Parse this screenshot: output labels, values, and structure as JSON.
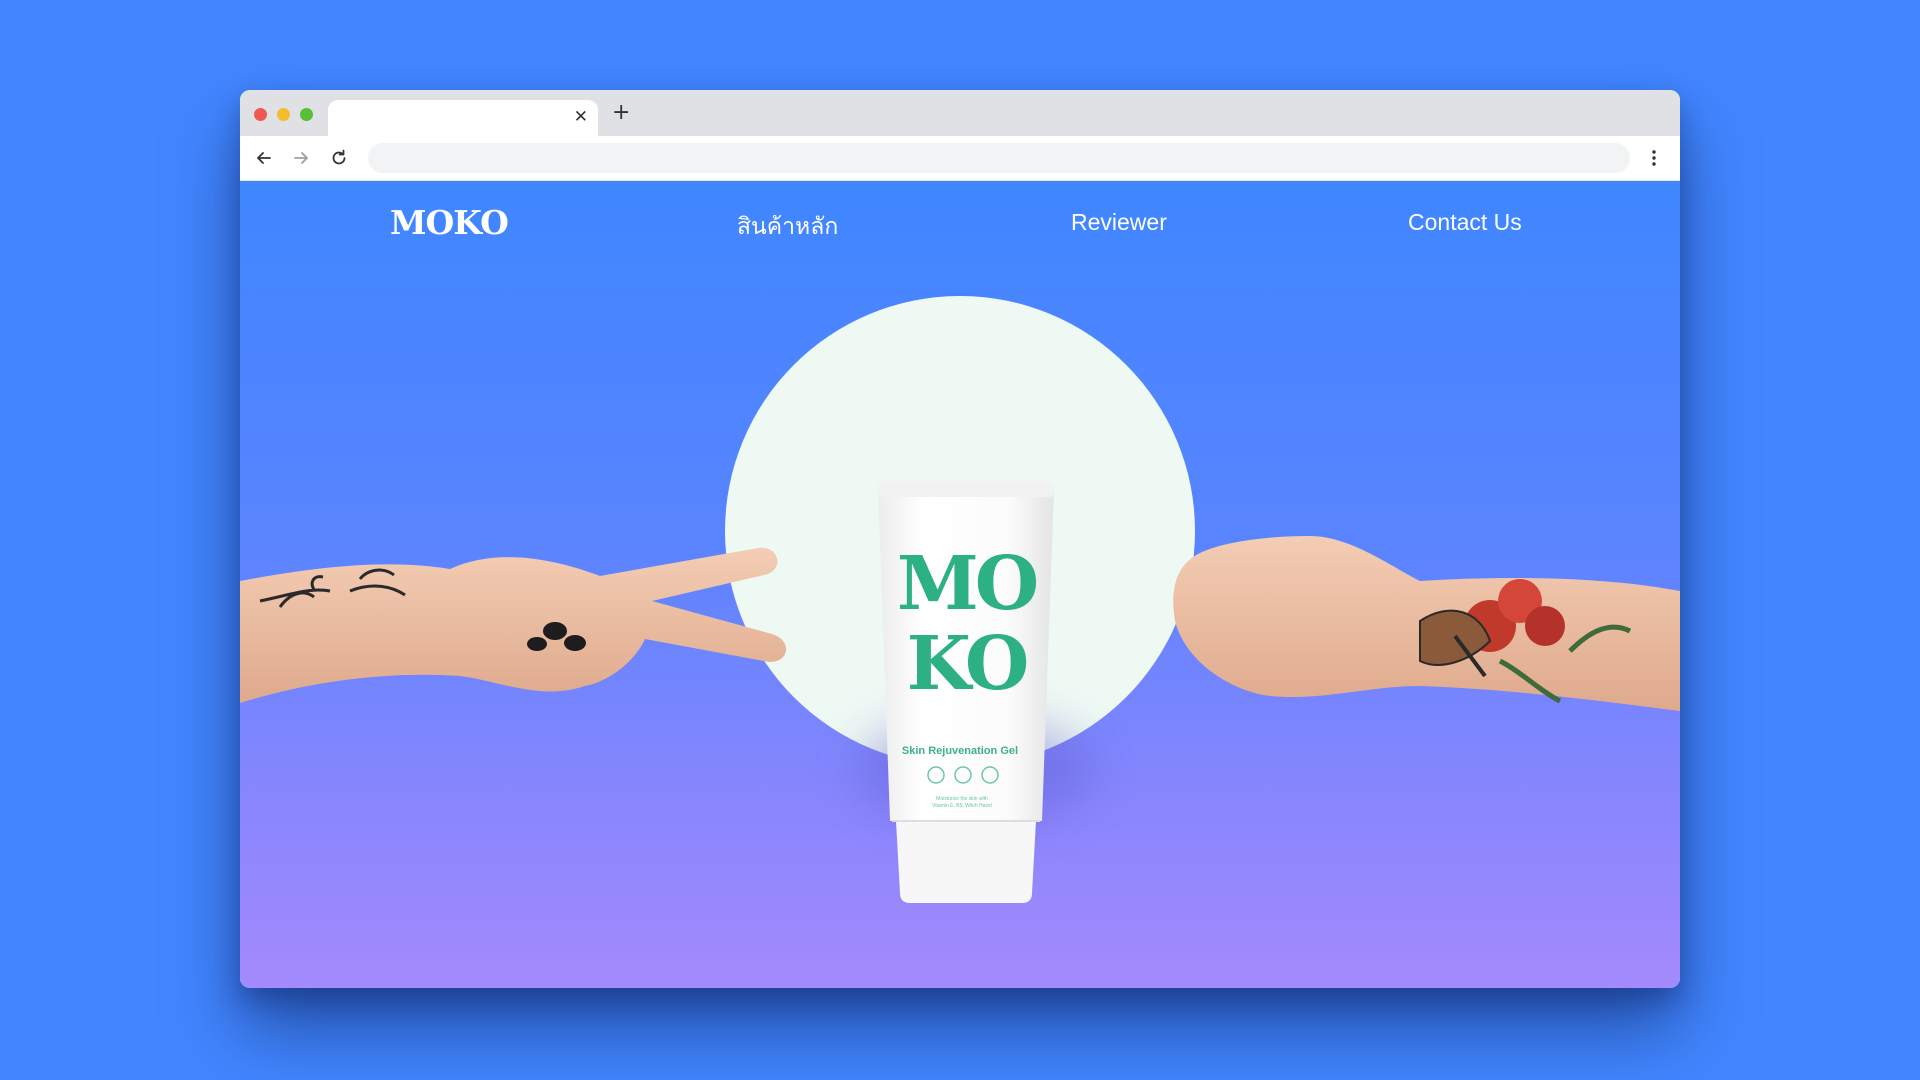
{
  "browser": {
    "tab_close_glyph": "✕",
    "new_tab_glyph": "+",
    "address_value": "",
    "controls": [
      "close-dot",
      "minimize-dot",
      "maximize-dot"
    ],
    "colors": {
      "close": "#ee5a52",
      "minimize": "#f4bd2f",
      "maximize": "#57c038"
    }
  },
  "nav": {
    "logo": "MOKO",
    "links": [
      "สินค้าหลัก",
      "Reviewer",
      "Contact Us"
    ]
  },
  "hero": {
    "product": {
      "brand_line1": "MO",
      "brand_line2": "KO",
      "name": "Skin Rejuvenation Gel",
      "small_line1": "Moisturize the skin with",
      "small_line2": "Vitamin E, B5, Witch Hazel"
    },
    "colors": {
      "accent_green": "#2db184",
      "circle": "#eef9f4",
      "page_bg": "#4286ff"
    }
  }
}
